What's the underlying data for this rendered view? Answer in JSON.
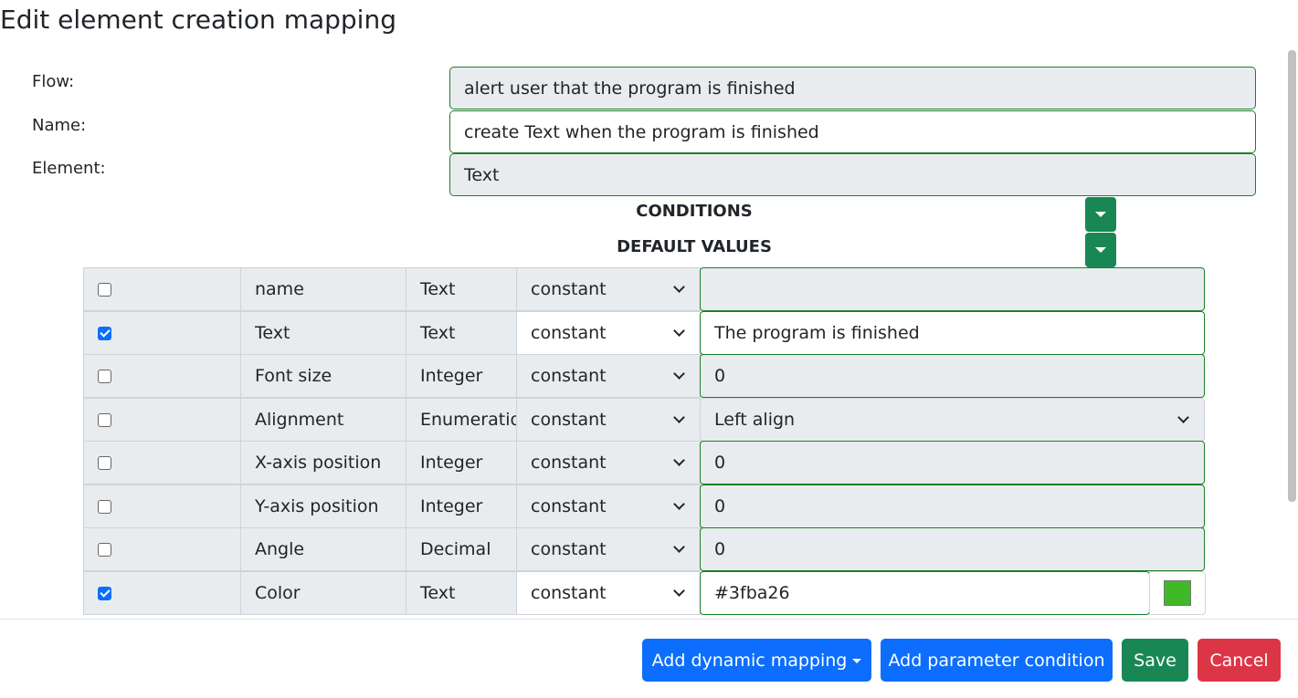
{
  "page": {
    "title": "Edit element creation mapping"
  },
  "form": {
    "flow": {
      "label": "Flow:",
      "value": "alert user that the program is finished"
    },
    "name": {
      "label": "Name:",
      "value": "create Text when the program is finished"
    },
    "element": {
      "label": "Element:",
      "value": "Text"
    }
  },
  "sections": {
    "conditions": "CONDITIONS",
    "default_values": "DEFAULT VALUES"
  },
  "defaults": [
    {
      "checked": false,
      "name": "name",
      "type": "Text",
      "mode": "constant",
      "value": ""
    },
    {
      "checked": true,
      "name": "Text",
      "type": "Text",
      "mode": "constant",
      "value": "The program is finished"
    },
    {
      "checked": false,
      "name": "Font size",
      "type": "Integer",
      "mode": "constant",
      "value": "0"
    },
    {
      "checked": false,
      "name": "Alignment",
      "type": "Enumeration",
      "mode": "constant",
      "value": "Left align"
    },
    {
      "checked": false,
      "name": "X-axis position",
      "type": "Integer",
      "mode": "constant",
      "value": "0"
    },
    {
      "checked": false,
      "name": "Y-axis position",
      "type": "Integer",
      "mode": "constant",
      "value": "0"
    },
    {
      "checked": false,
      "name": "Angle",
      "type": "Decimal",
      "mode": "constant",
      "value": "0"
    },
    {
      "checked": true,
      "name": "Color",
      "type": "Text",
      "mode": "constant",
      "value": "#3fba26"
    }
  ],
  "color_swatch": "#3fba26",
  "footer": {
    "add_dynamic_mapping": "Add dynamic mapping",
    "add_parameter_condition": "Add parameter condition",
    "save": "Save",
    "cancel": "Cancel"
  },
  "colors": {
    "primary": "#0d6efd",
    "success": "#198754",
    "danger": "#dc3545",
    "field_border": "#198027"
  }
}
